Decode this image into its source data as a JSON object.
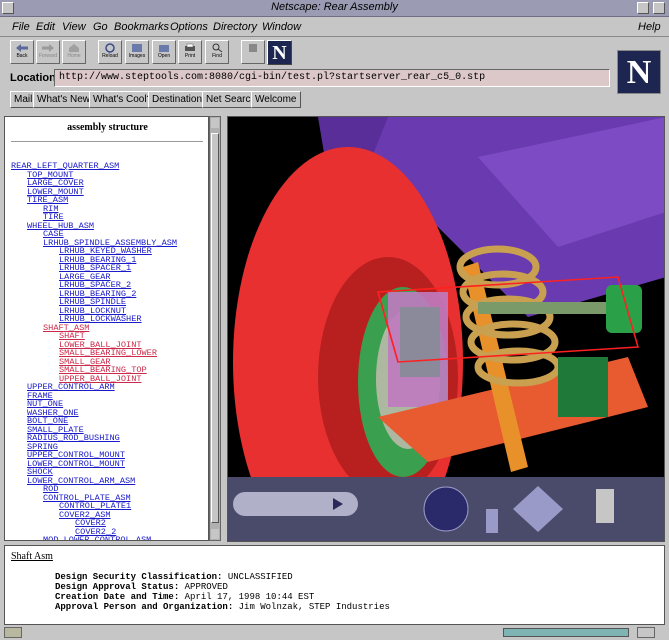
{
  "window": {
    "title": "Netscape: Rear Assembly"
  },
  "menubar": {
    "items": [
      "File",
      "Edit",
      "View",
      "Go",
      "Bookmarks",
      "Options",
      "Directory",
      "Window"
    ],
    "help": "Help"
  },
  "toolbar": {
    "buttons": [
      {
        "label": "Back",
        "icon": "back-arrow-icon"
      },
      {
        "label": "Forward",
        "icon": "forward-arrow-icon"
      },
      {
        "label": "Home",
        "icon": "home-icon"
      },
      {
        "label": "Reload",
        "icon": "reload-icon"
      },
      {
        "label": "Images",
        "icon": "images-icon"
      },
      {
        "label": "Open",
        "icon": "open-icon"
      },
      {
        "label": "Print",
        "icon": "print-icon"
      },
      {
        "label": "Find",
        "icon": "find-icon"
      },
      {
        "label": "",
        "icon": "stop-icon"
      }
    ],
    "logo_letter": "N"
  },
  "location": {
    "label": "Location:",
    "url": "http://www.steptools.com:8080/cgi-bin/test.pl?startserver_rear_c5_0.stp"
  },
  "directory_buttons": [
    "Mail",
    "What's New?",
    "What's Cool?",
    "Destinations",
    "Net Search",
    "Welcome"
  ],
  "tree": {
    "heading": "assembly structure",
    "items": [
      {
        "label": "REAR_LEFT_QUARTER_ASM",
        "level": 0,
        "highlight": false
      },
      {
        "label": "TOP_MOUNT",
        "level": 1,
        "highlight": false
      },
      {
        "label": "LARGE_COVER",
        "level": 1,
        "highlight": false
      },
      {
        "label": "LOWER_MOUNT",
        "level": 1,
        "highlight": false
      },
      {
        "label": "TIRE_ASM",
        "level": 1,
        "highlight": false
      },
      {
        "label": "RIM",
        "level": 2,
        "highlight": false
      },
      {
        "label": "TIRE",
        "level": 2,
        "highlight": false
      },
      {
        "label": "WHEEL_HUB_ASM",
        "level": 1,
        "highlight": false
      },
      {
        "label": "CASE",
        "level": 2,
        "highlight": false
      },
      {
        "label": "LRHUB_SPINDLE_ASSEMBLY_ASM",
        "level": 2,
        "highlight": false
      },
      {
        "label": "LRHUB_KEYED_WASHER",
        "level": 3,
        "highlight": false
      },
      {
        "label": "LRHUB_BEARING_1",
        "level": 3,
        "highlight": false
      },
      {
        "label": "LRHUB_SPACER_1",
        "level": 3,
        "highlight": false
      },
      {
        "label": "LARGE_GEAR",
        "level": 3,
        "highlight": false
      },
      {
        "label": "LRHUB_SPACER_2",
        "level": 3,
        "highlight": false
      },
      {
        "label": "LRHUB_BEARING_2",
        "level": 3,
        "highlight": false
      },
      {
        "label": "LRHUB_SPINDLE",
        "level": 3,
        "highlight": false
      },
      {
        "label": "LRHUB_LOCKNUT",
        "level": 3,
        "highlight": false
      },
      {
        "label": "LRHUB_LOCKWASHER",
        "level": 3,
        "highlight": false
      },
      {
        "label": "SHAFT_ASM",
        "level": 2,
        "highlight": true
      },
      {
        "label": "SHAFT",
        "level": 3,
        "highlight": true
      },
      {
        "label": "LOWER_BALL_JOINT",
        "level": 3,
        "highlight": true
      },
      {
        "label": "SMALL_BEARING_LOWER",
        "level": 3,
        "highlight": true
      },
      {
        "label": "SMALL_GEAR",
        "level": 3,
        "highlight": true
      },
      {
        "label": "SMALL_BEARING_TOP",
        "level": 3,
        "highlight": true
      },
      {
        "label": "UPPER_BALL_JOINT",
        "level": 3,
        "highlight": true
      },
      {
        "label": "UPPER_CONTROL_ARM",
        "level": 1,
        "highlight": false
      },
      {
        "label": "FRAME",
        "level": 1,
        "highlight": false
      },
      {
        "label": "NUT_ONE",
        "level": 1,
        "highlight": false
      },
      {
        "label": "WASHER_ONE",
        "level": 1,
        "highlight": false
      },
      {
        "label": "BOLT_ONE",
        "level": 1,
        "highlight": false
      },
      {
        "label": "SMALL_PLATE",
        "level": 1,
        "highlight": false
      },
      {
        "label": "RADIUS_ROD_BUSHING",
        "level": 1,
        "highlight": false
      },
      {
        "label": "SPRING",
        "level": 1,
        "highlight": false
      },
      {
        "label": "UPPER_CONTROL_MOUNT",
        "level": 1,
        "highlight": false
      },
      {
        "label": "LOWER_CONTROL_MOUNT",
        "level": 1,
        "highlight": false
      },
      {
        "label": "SHOCK",
        "level": 1,
        "highlight": false
      },
      {
        "label": "LOWER_CONTROL_ARM_ASM",
        "level": 1,
        "highlight": false
      },
      {
        "label": "ROD",
        "level": 2,
        "highlight": false
      },
      {
        "label": "CONTROL_PLATE_ASM",
        "level": 2,
        "highlight": false
      },
      {
        "label": "CONTROL_PLATE1",
        "level": 3,
        "highlight": false
      },
      {
        "label": "COVER2_ASM",
        "level": 3,
        "highlight": false
      },
      {
        "label": "COVER2",
        "level": 4,
        "highlight": false
      },
      {
        "label": "COVER2_2",
        "level": 4,
        "highlight": false
      },
      {
        "label": "MOD_LOWER_CONTROL_ASM",
        "level": 2,
        "highlight": false
      }
    ]
  },
  "info": {
    "title": "Shaft Asm",
    "rows": [
      {
        "label": "Design Security Classification:",
        "value": "UNCLASSIFIED"
      },
      {
        "label": "Design Approval Status:",
        "value": "APPROVED"
      },
      {
        "label": "Creation Date and Time:",
        "value": "April 17, 1998  10:44 EST"
      },
      {
        "label": "Approval Person and Organization:",
        "value": "Jim Wolnzak, STEP Industries"
      }
    ]
  },
  "colors": {
    "tire": "#e83030",
    "frame": "#6a3ab0",
    "spring": "#c8a050",
    "hub": "#3aa050",
    "control_panel": "#4a4a6a",
    "link": "#1a1ac8",
    "link_highlight": "#cc2a4a"
  }
}
